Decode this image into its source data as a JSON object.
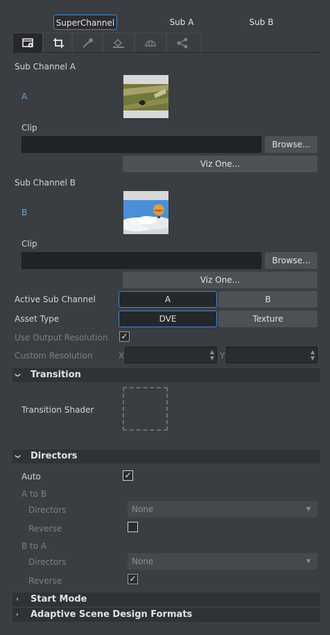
{
  "tabs": [
    {
      "label": "SuperChannel",
      "active": true
    },
    {
      "label": "Sub A",
      "active": false
    },
    {
      "label": "Sub B",
      "active": false
    }
  ],
  "icon_tabs": [
    "film-settings-icon",
    "crop-icon",
    "key-icon",
    "fill-bucket-icon",
    "mask-icon",
    "link-nodes-icon"
  ],
  "sub_channel_a": {
    "heading": "Sub Channel A",
    "letter": "A",
    "clip_label": "Clip",
    "clip_value": "",
    "browse_label": "Browse...",
    "vizone_label": "Viz One..."
  },
  "sub_channel_b": {
    "heading": "Sub Channel B",
    "letter": "B",
    "clip_label": "Clip",
    "clip_value": "",
    "browse_label": "Browse...",
    "vizone_label": "Viz One..."
  },
  "active_sub_channel": {
    "label": "Active Sub Channel",
    "options": [
      "A",
      "B"
    ],
    "selected": "A"
  },
  "asset_type": {
    "label": "Asset Type",
    "options": [
      "DVE",
      "Texture"
    ],
    "selected": "DVE"
  },
  "use_output_resolution": {
    "label": "Use Output Resolution",
    "checked": true
  },
  "custom_resolution": {
    "label": "Custom Resolution",
    "x_label": "X",
    "y_label": "Y",
    "x_value": "",
    "y_value": ""
  },
  "transition": {
    "title": "Transition",
    "shader_label": "Transition Shader"
  },
  "directors": {
    "title": "Directors",
    "auto_label": "Auto",
    "auto_checked": true,
    "a_to_b": {
      "label": "A to B",
      "directors_label": "Directors",
      "directors_value": "None",
      "reverse_label": "Reverse",
      "reverse_checked": false
    },
    "b_to_a": {
      "label": "B to A",
      "directors_label": "Directors",
      "directors_value": "None",
      "reverse_label": "Reverse",
      "reverse_checked": true
    }
  },
  "start_mode": {
    "title": "Start Mode"
  },
  "adaptive": {
    "title": "Adaptive Scene Design Formats"
  },
  "colors": {
    "background": "#3a3d41",
    "accent": "#3f89d3",
    "label_blue": "#6aa3d8"
  }
}
